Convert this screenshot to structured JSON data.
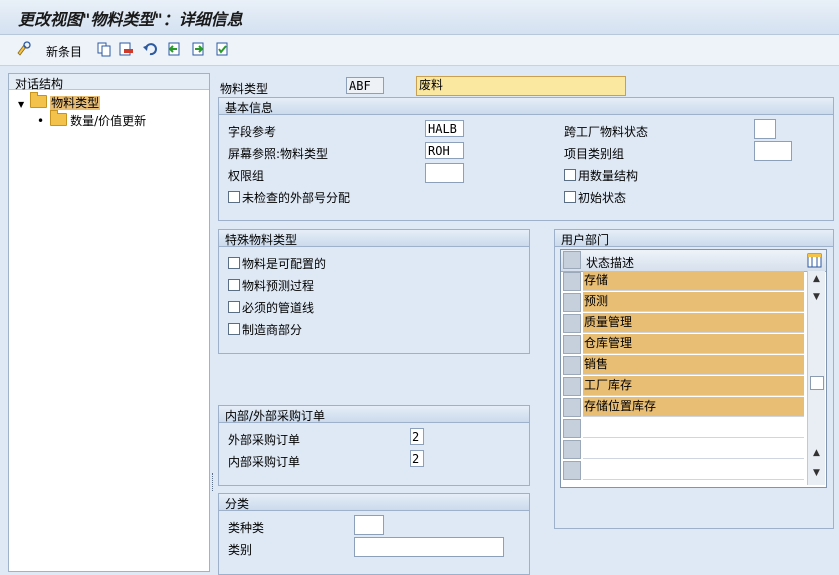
{
  "window": {
    "title": "更改视图\"物料类型\"：详细信息"
  },
  "toolbar": {
    "new_entries_label": "新条目"
  },
  "tree": {
    "header": "对话结构",
    "nodes": [
      {
        "label": "物料类型",
        "expanded": true
      },
      {
        "label": "数量/价值更新"
      }
    ]
  },
  "material_type": {
    "label": "物料类型",
    "code": "ABF",
    "description": "废料"
  },
  "basic_info": {
    "title": "基本信息",
    "field_ref_label": "字段参考",
    "field_ref_value": "HALB",
    "screen_ref_label": "屏幕参照:物料类型",
    "screen_ref_value": "ROH",
    "auth_group_label": "权限组",
    "auth_group_value": "",
    "unchecked_ext_label": "未检查的外部号分配",
    "xplant_status_label": "跨工厂物料状态",
    "xplant_status_value": "",
    "item_cat_group_label": "项目类别组",
    "item_cat_group_value": "",
    "qty_structure_label": "用数量结构",
    "initial_status_label": "初始状态"
  },
  "special_types": {
    "title": "特殊物料类型",
    "configurable_label": "物料是可配置的",
    "planning_label": "物料预测过程",
    "pipeline_label": "必须的管道线",
    "mfr_part_label": "制造商部分"
  },
  "po": {
    "title": "内部/外部采购订单",
    "external_label": "外部采购订单",
    "external_value": "2",
    "internal_label": "内部采购订单",
    "internal_value": "2"
  },
  "classification": {
    "title": "分类",
    "class_type_label": "类种类",
    "class_type_value": "",
    "class_label": "类别",
    "class_value": ""
  },
  "user_dept": {
    "title": "用户部门",
    "column_header": "状态描述",
    "rows": [
      "存储",
      "预测",
      "质量管理",
      "仓库管理",
      "销售",
      "工厂库存",
      "存储位置库存",
      "",
      "",
      ""
    ],
    "row_highlight_color": "#e8bd74"
  }
}
